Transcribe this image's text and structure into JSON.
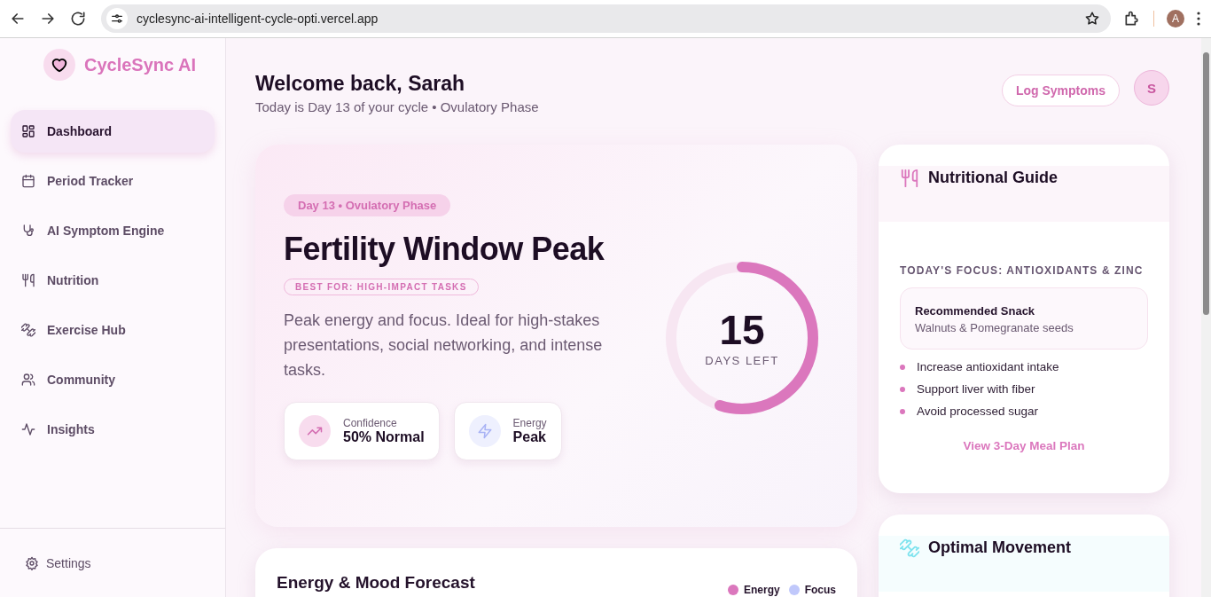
{
  "browser": {
    "url": "cyclesync-ai-intelligent-cycle-opti.vercel.app",
    "profile_initial": "A"
  },
  "sidebar": {
    "brand": "CycleSync AI",
    "items": [
      {
        "label": "Dashboard",
        "selected": true
      },
      {
        "label": "Period Tracker",
        "selected": false
      },
      {
        "label": "AI Symptom Engine",
        "selected": false
      },
      {
        "label": "Nutrition",
        "selected": false
      },
      {
        "label": "Exercise Hub",
        "selected": false
      },
      {
        "label": "Community",
        "selected": false
      },
      {
        "label": "Insights",
        "selected": false
      }
    ],
    "footer_item": {
      "label": "Settings"
    }
  },
  "header": {
    "title": "Welcome back, Sarah",
    "subtitle": "Today is Day 13 of your cycle • Ovulatory Phase",
    "action": "Log Symptoms",
    "avatar": "S"
  },
  "hero": {
    "badge": "Day 13 • Ovulatory Phase",
    "title": "Fertility Window Peak",
    "tag": "BEST FOR: HIGH-IMPACT TASKS",
    "description": "Peak energy and focus. Ideal for high-stakes presentations, social networking, and intense tasks.",
    "stats": [
      {
        "label": "Confidence",
        "value": "50% Normal"
      },
      {
        "label": "Energy",
        "value": "Peak"
      }
    ],
    "ring": {
      "value": "15",
      "caption": "DAYS LEFT",
      "level": 0.55
    }
  },
  "nutrition": {
    "title": "Nutritional Guide",
    "focus": "TODAY'S FOCUS: ANTIOXIDANTS & ZINC",
    "snack_title": "Recommended Snack",
    "snack": "Walnuts & Pomegranate seeds",
    "tips": [
      "Increase antioxidant intake",
      "Support liver with fiber",
      "Avoid processed sugar"
    ],
    "link": "View 3-Day Meal Plan"
  },
  "movement": {
    "title": "Optimal Movement"
  },
  "forecast": {
    "title": "Energy & Mood Forecast",
    "legend": [
      {
        "label": "Energy",
        "color": "#db77bd"
      },
      {
        "label": "Focus",
        "color": "#c0c8fb"
      }
    ]
  }
}
